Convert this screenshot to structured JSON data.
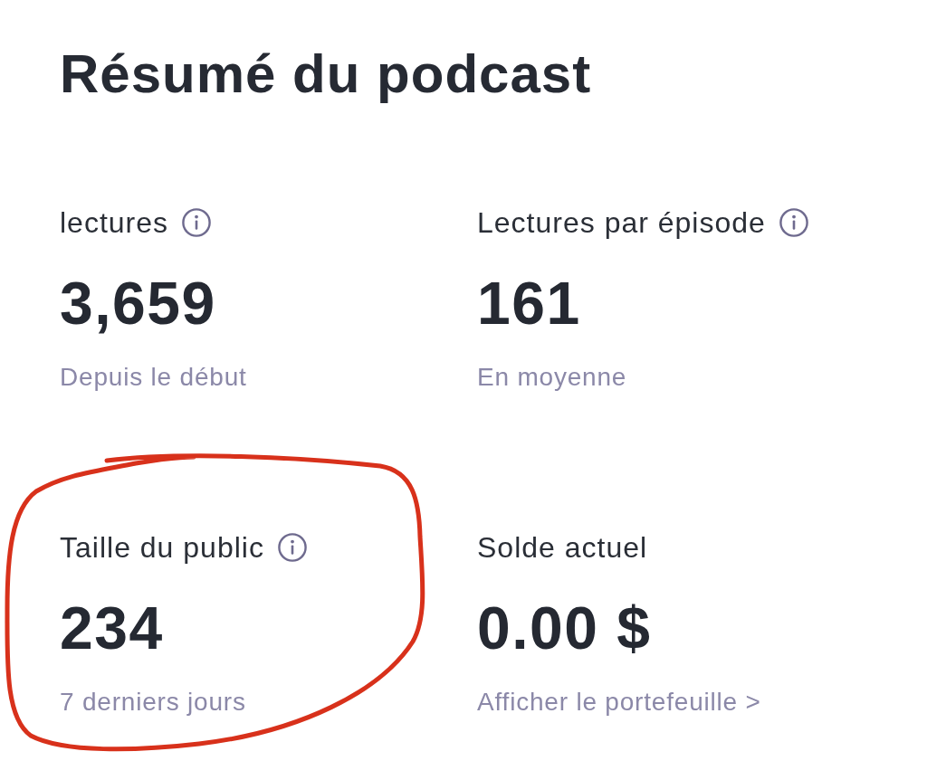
{
  "title": "Résumé du podcast",
  "stats": [
    {
      "label": "lectures",
      "info": true,
      "value": "3,659",
      "caption": "Depuis le début",
      "highlighted": false
    },
    {
      "label": "Lectures par épisode",
      "info": true,
      "value": "161",
      "caption": "En moyenne",
      "highlighted": false
    },
    {
      "label": "Taille du public",
      "info": true,
      "value": "234",
      "caption": "7 derniers jours",
      "highlighted": true
    },
    {
      "label": "Solde actuel",
      "info": false,
      "value": "0.00 $",
      "link": "Afficher le portefeuille >",
      "highlighted": false
    }
  ]
}
